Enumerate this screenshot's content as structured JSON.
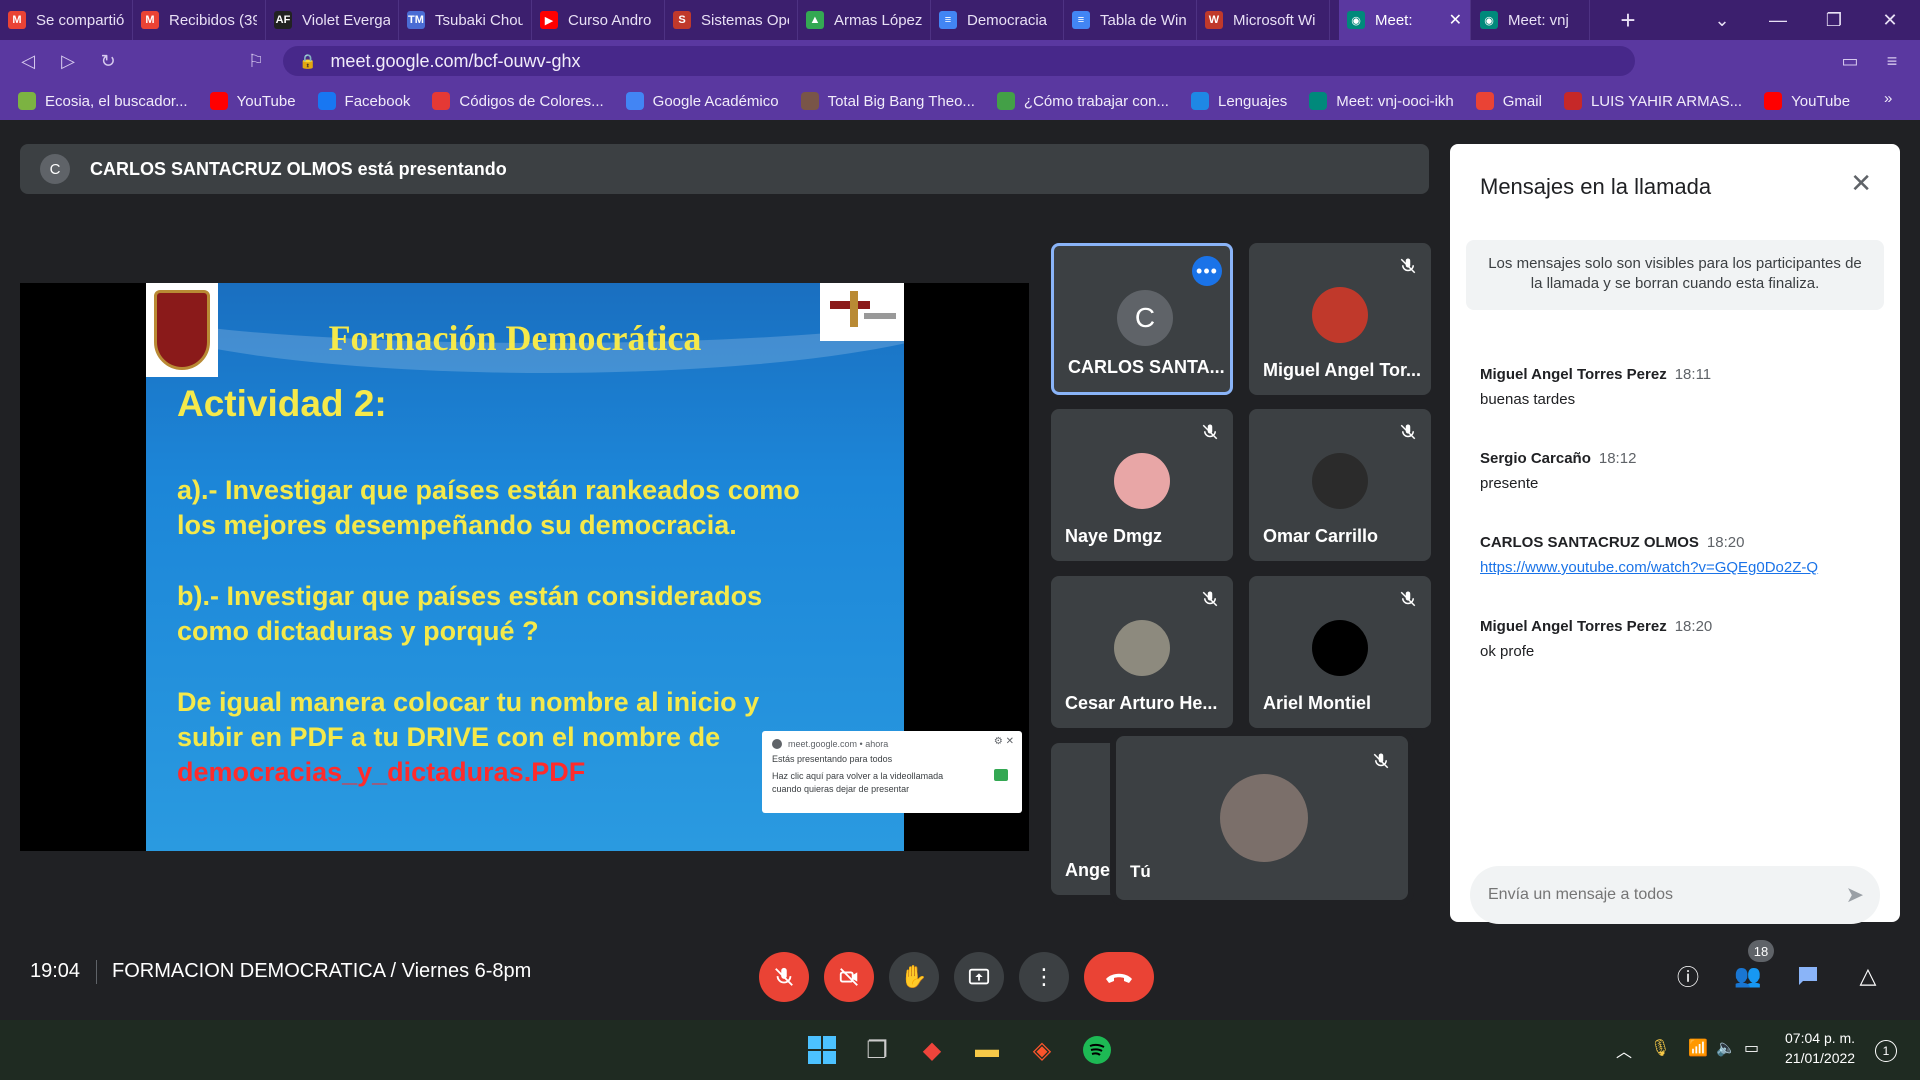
{
  "browser": {
    "tabs": [
      {
        "label": "Se compartió",
        "fav_color": "#ea4335",
        "fav_glyph": "M"
      },
      {
        "label": "Recibidos (39",
        "fav_color": "#ea4335",
        "fav_glyph": "M"
      },
      {
        "label": "Violet Everga",
        "fav_color": "#222222",
        "fav_glyph": "AF"
      },
      {
        "label": "Tsubaki Chou",
        "fav_color": "#4a6cd4",
        "fav_glyph": "TM"
      },
      {
        "label": "Curso Andro",
        "fav_color": "#ff0000",
        "fav_glyph": "▶"
      },
      {
        "label": "Sistemas Ope",
        "fav_color": "#c0392b",
        "fav_glyph": "S"
      },
      {
        "label": "Armas López",
        "fav_color": "#34a853",
        "fav_glyph": "▲"
      },
      {
        "label": "Democracia",
        "fav_color": "#4285f4",
        "fav_glyph": "≡"
      },
      {
        "label": "Tabla de Win",
        "fav_color": "#4285f4",
        "fav_glyph": "≡"
      },
      {
        "label": "Microsoft Wi",
        "fav_color": "#c0392b",
        "fav_glyph": "W"
      }
    ],
    "active_tab": {
      "label": "Meet:",
      "close": "✕"
    },
    "last_tab": {
      "label": "Meet: vnj"
    },
    "new_tab": "+",
    "url": "meet.google.com/bcf-ouwv-ghx",
    "bookmarks": [
      {
        "label": "Ecosia, el buscador...",
        "color": "#7cb342"
      },
      {
        "label": "YouTube",
        "color": "#ff0000"
      },
      {
        "label": "Facebook",
        "color": "#1877f2"
      },
      {
        "label": "Códigos de Colores...",
        "color": "#e53935"
      },
      {
        "label": "Google Académico",
        "color": "#4285f4"
      },
      {
        "label": "Total Big Bang Theo...",
        "color": "#795548"
      },
      {
        "label": "¿Cómo trabajar con...",
        "color": "#43a047"
      },
      {
        "label": "Lenguajes",
        "color": "#1e88e5"
      },
      {
        "label": "Meet: vnj-ooci-ikh",
        "color": "#00897b"
      },
      {
        "label": "Gmail",
        "color": "#ea4335"
      },
      {
        "label": "LUIS YAHIR ARMAS...",
        "color": "#c62828"
      },
      {
        "label": "YouTube",
        "color": "#ff0000"
      }
    ],
    "bookmarks_more": "»"
  },
  "meet": {
    "presenter_initial": "C",
    "presenting_text": "CARLOS SANTACRUZ OLMOS está presentando",
    "slide": {
      "title": "Formación Democrática",
      "activity": "Actividad 2:",
      "para_a_line1": "a).- Investigar que países están rankeados como",
      "para_a_line2": "los mejores desempeñando su democracia.",
      "para_b_line1": "b).- Investigar que países están considerados",
      "para_b_line2": "como dictaduras  y porqué  ?",
      "para_c_line1": "De igual manera colocar tu nombre al inicio y",
      "para_c_line2": "subir en PDF a tu DRIVE con el nombre de",
      "filename": "democracias_y_dictaduras.PDF"
    },
    "toast": {
      "source": "meet.google.com",
      "when": "ahora",
      "title": "Estás presentando para todos",
      "body": "Haz clic aquí para volver a la videollamada cuando quieras dejar de presentar"
    },
    "participants": [
      {
        "name": "CARLOS SANTA...",
        "initial": "C",
        "avatar_color": "#5f6368",
        "selected": true
      },
      {
        "name": "Miguel Angel Tor...",
        "initial": "",
        "avatar_color": "#c0392b"
      },
      {
        "name": "Naye Dmgz",
        "initial": "",
        "avatar_color": "#e8a6a6"
      },
      {
        "name": "Omar Carrillo",
        "initial": "",
        "avatar_color": "#2b2b2b"
      },
      {
        "name": "Cesar Arturo He...",
        "initial": "",
        "avatar_color": "#8d8a7e"
      },
      {
        "name": "Ariel Montiel",
        "initial": "",
        "avatar_color": "#000000"
      },
      {
        "name": "Angel",
        "initial": "",
        "avatar_color": "#3c4043"
      }
    ],
    "self_tile": {
      "name": "Tú",
      "avatar_color": "#7b6f6a"
    },
    "chat": {
      "title": "Mensajes en la llamada",
      "notice": "Los mensajes solo son visibles para los participantes de la llamada y se borran cuando esta finaliza.",
      "messages": [
        {
          "sender": "Miguel Angel Torres Perez",
          "time": "18:11",
          "text": "buenas tardes"
        },
        {
          "sender": "Sergio Carcaño",
          "time": "18:12",
          "text": "presente"
        },
        {
          "sender": "CARLOS SANTACRUZ OLMOS",
          "time": "18:20",
          "text": "https://www.youtube.com/watch?v=GQEg0Do2Z-Q"
        },
        {
          "sender": "Miguel Angel Torres Perez",
          "time": "18:20",
          "text": "ok profe"
        }
      ],
      "input_placeholder": "Envía un mensaje a todos"
    },
    "controls": {
      "clock": "19:04",
      "meeting_name": "FORMACION DEMOCRATICA / Viernes 6-8pm",
      "participants_count": "18"
    }
  },
  "taskbar": {
    "time": "07:04 p. m.",
    "date": "21/01/2022",
    "notifications": "1"
  }
}
